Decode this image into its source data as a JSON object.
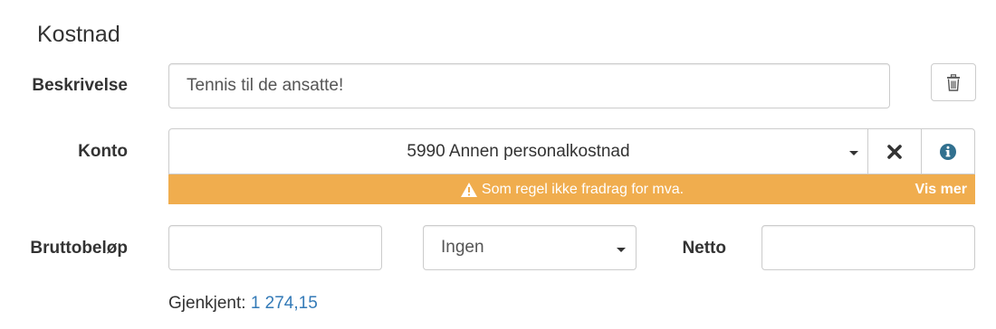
{
  "section": {
    "title": "Kostnad"
  },
  "beskrivelse": {
    "label": "Beskrivelse",
    "value": "Tennis til de ansatte!"
  },
  "delete": {
    "icon": "trash-icon"
  },
  "konto": {
    "label": "Konto",
    "selected": "5990 Annen personalkostnad",
    "clear_icon": "close-icon",
    "info_icon": "info-icon"
  },
  "warning": {
    "icon": "warning-icon",
    "text": "Som regel ikke fradrag for mva.",
    "link": "Vis mer",
    "color": "#f0ad4e"
  },
  "brutto": {
    "label": "Bruttobeløp",
    "value": ""
  },
  "mva": {
    "selected": "Ingen"
  },
  "netto": {
    "label": "Netto",
    "value": ""
  },
  "recognized": {
    "label": "Gjenkjent:",
    "amount": "1 274,15",
    "color": "#337ab7"
  }
}
